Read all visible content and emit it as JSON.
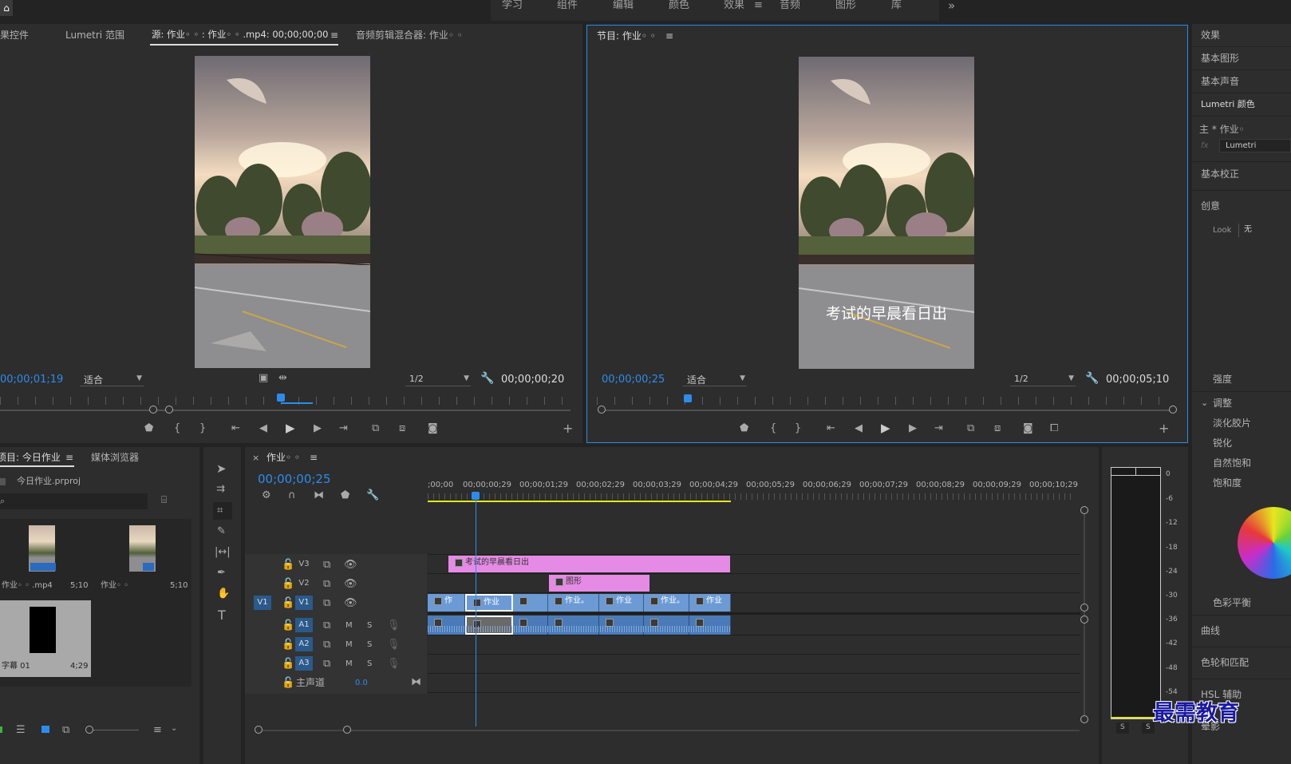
{
  "workspaces": [
    "学习",
    "组件",
    "编辑",
    "颜色",
    "效果",
    "音频",
    "图形",
    "库"
  ],
  "workspace_active": "效果",
  "overflow": "»",
  "source_tabs": [
    "效果控件",
    "Lumetri 范围",
    "源: 作业◦ ◦ : 作业◦ ◦ .mp4: 00;00;00;00",
    "音频剪辑混合器: 作业◦ ◦"
  ],
  "source": {
    "timecode_left": "00;00;01;19",
    "fit": "适合",
    "res": "1/2",
    "timecode_right": "00;00;00;20"
  },
  "program": {
    "title": "节目: 作业◦ ◦",
    "caption": "考试的早晨看日出",
    "timecode_left": "00;00;00;25",
    "fit": "适合",
    "res": "1/2",
    "timecode_right": "00;00;05;10"
  },
  "right_panel": {
    "items": [
      "效果",
      "基本图形",
      "基本声音",
      "Lumetri 颜色"
    ],
    "master": "主 * 作业◦",
    "fx_label": "fx",
    "fx_value": "Lumetri",
    "section_basic": "基本校正",
    "section_creative": "创意",
    "look_label": "Look",
    "look_value": "无",
    "intensity": "强度",
    "adjust": "调整",
    "adjust_items": [
      "淡化胶片",
      "锐化",
      "自然饱和",
      "饱和度"
    ],
    "color_balance": "色彩平衡",
    "curves": "曲线",
    "wheels": "色轮和匹配",
    "hsl": "HSL 辅助",
    "vignette": "晕影"
  },
  "project": {
    "tabs": [
      "项目: 今日作业",
      "媒体浏览器"
    ],
    "file": "今日作业.prproj",
    "items": [
      {
        "name": "作业◦ ◦ .mp4",
        "dur": "5;10"
      },
      {
        "name": "作业◦ ◦",
        "dur": "5;10"
      },
      {
        "name": "字幕 01",
        "dur": "4;29"
      }
    ]
  },
  "timeline": {
    "title": "作业◦ ◦",
    "timecode": "00;00;00;25",
    "ruler": [
      ";00;00",
      "00;00;00;29",
      "00;00;01;29",
      "00;00;02;29",
      "00;00;03;29",
      "00;00;04;29",
      "00;00;05;29",
      "00;00;06;29",
      "00;00;07;29",
      "00;00;08;29",
      "00;00;09;29",
      "00;00;10;29"
    ],
    "tracks_video": [
      "V3",
      "V2",
      "V1"
    ],
    "tracks_audio": [
      "A1",
      "A2",
      "A3"
    ],
    "source_patch": "V1",
    "master_label": "主声道",
    "master_value": "0.0",
    "m": "M",
    "s": "S",
    "title_clip": "考试的早晨看日出",
    "graphic_clip": "图形",
    "v1_clips": [
      "作",
      "作业",
      "",
      "作业。",
      "作业",
      "作业。",
      "作业"
    ]
  },
  "meter": {
    "scale": [
      "0",
      "-6",
      "-12",
      "-18",
      "-24",
      "-30",
      "-36",
      "-42",
      "-48",
      "-54"
    ],
    "solo": [
      "S",
      "S"
    ]
  },
  "watermark": "最需教育",
  "colors": {
    "accent": "#2d8ceb",
    "title_clip": "#e58be5",
    "video_clip": "#6b9ad4",
    "audio_clip": "#4a7bb8",
    "work_area": "#e6e61e"
  }
}
